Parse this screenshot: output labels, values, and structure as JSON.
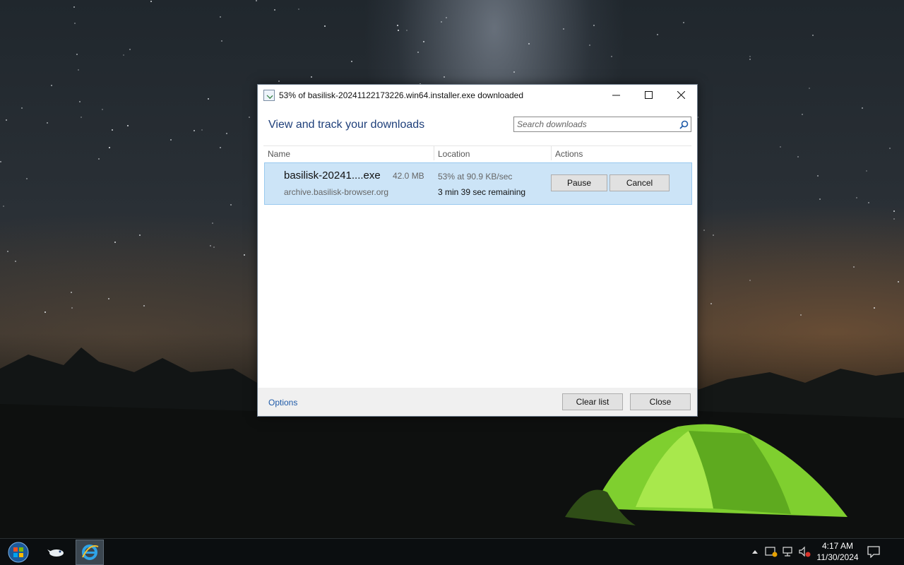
{
  "window": {
    "title": "53% of basilisk-20241122173226.win64.installer.exe downloaded",
    "controls": {
      "minimize": "—",
      "maximize": "☐",
      "close": "✕"
    }
  },
  "header": {
    "heading": "View and track your downloads",
    "search_placeholder": "Search downloads"
  },
  "columns": {
    "name": "Name",
    "location": "Location",
    "actions": "Actions"
  },
  "downloads": [
    {
      "name": "basilisk-20241....exe",
      "size": "42.0 MB",
      "source": "archive.basilisk-browser.org",
      "progress_text": "53% at 90.9 KB/sec",
      "progress_percent": 53,
      "remaining": "3 min 39 sec remaining",
      "pause_label": "Pause",
      "cancel_label": "Cancel"
    }
  ],
  "footer": {
    "options_label": "Options",
    "clear_label": "Clear list",
    "close_label": "Close"
  },
  "taskbar": {
    "time": "4:17 AM",
    "date": "11/30/2024",
    "pinned": [
      "start-orb-icon",
      "app-bird-icon",
      "internet-explorer-icon"
    ]
  },
  "colors": {
    "heading": "#1e3f7a",
    "selected_row": "#cce4f7",
    "link": "#1e5aa8"
  }
}
